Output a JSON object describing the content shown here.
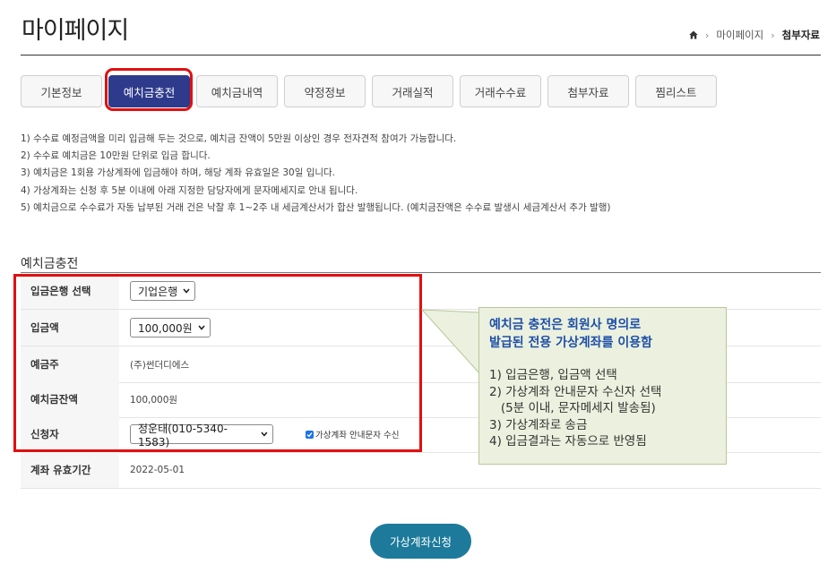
{
  "header": {
    "title": "마이페이지",
    "breadcrumb": [
      "마이페이지",
      "첨부자료"
    ]
  },
  "tabs": [
    {
      "label": "기본정보",
      "active": false
    },
    {
      "label": "예치금충전",
      "active": true
    },
    {
      "label": "예치금내역",
      "active": false
    },
    {
      "label": "약정정보",
      "active": false
    },
    {
      "label": "거래실적",
      "active": false
    },
    {
      "label": "거래수수료",
      "active": false
    },
    {
      "label": "첨부자료",
      "active": false
    },
    {
      "label": "찜리스트",
      "active": false
    }
  ],
  "notes": [
    "1) 수수료 예정금액을 미리 입금해 두는 것으로, 예치금 잔액이 5만원 이상인 경우 전자견적 참여가 가능합니다.",
    "2) 수수료 예치금은 10만원 단위로 입금 합니다.",
    "3) 예치금은 1회용 가상계좌에 입금해야 하며, 해당 계좌 유효일은 30일 입니다.",
    "4) 가상계좌는 신청 후 5분 이내에 아래 지정한 담당자에게 문자메세지로 안내 됩니다.",
    "5) 예치금으로 수수료가 자동 납부된 거래 건은 낙찰 후 1~2주 내 세금계산서가 합산 발행됩니다. (예치금잔액은 수수료 발생시 세금계산서 추가 발행)"
  ],
  "section_title": "예치금충전",
  "form": {
    "bank": {
      "label": "입금은행 선택",
      "value": "기업은행"
    },
    "amount": {
      "label": "입금액",
      "value": "100,000원"
    },
    "depositor": {
      "label": "예금주",
      "value": "(주)썬더디에스"
    },
    "balance": {
      "label": "예치금잔액",
      "value": "100,000원"
    },
    "applicant": {
      "label": "신청자",
      "value": "정운태(010-5340-1583)",
      "sms_label": "가상계좌 안내문자 수신",
      "sms_checked": true
    },
    "expiry": {
      "label": "계좌 유효기간",
      "value": "2022-05-01"
    }
  },
  "callout": {
    "title": "예치금 충전은 회원사 명의로\n발급된 전용 가상계좌를 이용함",
    "steps": "1) 입금은행, 입금액 선택\n2) 가상계좌 안내문자 수신자 선택\n   (5분 이내, 문자메세지 발송됨)\n3) 가상계좌로 송금\n4) 입금결과는 자동으로 반영됨"
  },
  "submit_label": "가상계좌신청",
  "colors": {
    "active_tab": "#2e3a8c",
    "highlight": "#e01010",
    "button": "#1d7a9b",
    "callout_bg": "#ebf1de"
  }
}
